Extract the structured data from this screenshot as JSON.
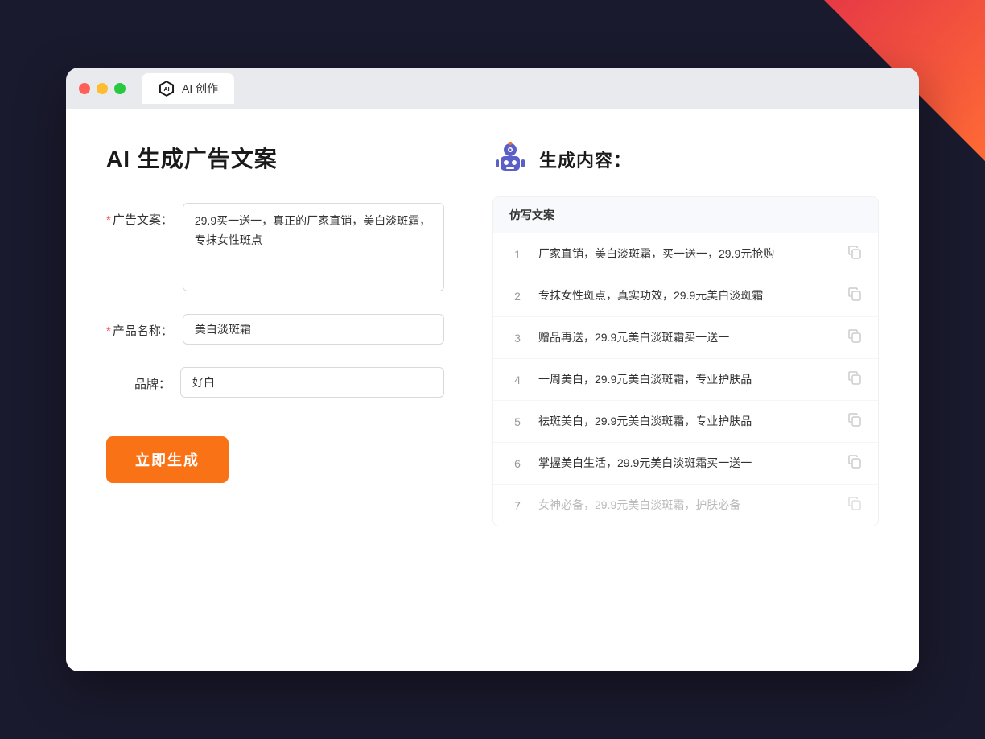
{
  "window": {
    "tab_label": "AI 创作"
  },
  "left_panel": {
    "title": "AI 生成广告文案",
    "fields": {
      "ad_copy_label": "广告文案：",
      "ad_copy_required": "*",
      "ad_copy_value": "29.9买一送一，真正的厂家直销，美白淡斑霜，专抹女性斑点",
      "product_name_label": "产品名称：",
      "product_name_required": "*",
      "product_name_value": "美白淡斑霜",
      "brand_label": "品牌：",
      "brand_value": "好白"
    },
    "generate_button": "立即生成"
  },
  "right_panel": {
    "title": "生成内容：",
    "table_header": "仿写文案",
    "results": [
      {
        "num": "1",
        "text": "厂家直销，美白淡斑霜，买一送一，29.9元抢购",
        "faded": false
      },
      {
        "num": "2",
        "text": "专抹女性斑点，真实功效，29.9元美白淡斑霜",
        "faded": false
      },
      {
        "num": "3",
        "text": "赠品再送，29.9元美白淡斑霜买一送一",
        "faded": false
      },
      {
        "num": "4",
        "text": "一周美白，29.9元美白淡斑霜，专业护肤品",
        "faded": false
      },
      {
        "num": "5",
        "text": "祛斑美白，29.9元美白淡斑霜，专业护肤品",
        "faded": false
      },
      {
        "num": "6",
        "text": "掌握美白生活，29.9元美白淡斑霜买一送一",
        "faded": false
      },
      {
        "num": "7",
        "text": "女神必备，29.9元美白淡斑霜，护肤必备",
        "faded": true
      }
    ]
  }
}
